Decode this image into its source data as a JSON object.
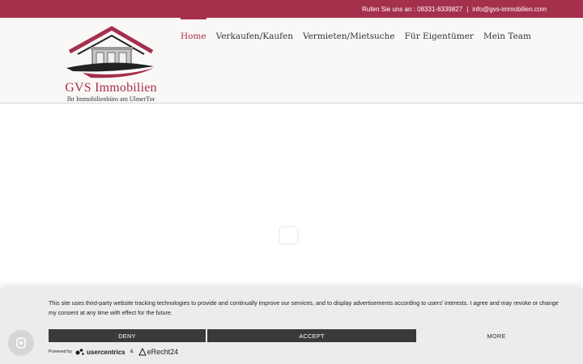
{
  "topbar": {
    "phone_text": "Rufen Sie uns an : 08331-8339827",
    "separator": "|",
    "email": "info@gvs-immobilien.com"
  },
  "logo": {
    "title": "GVS Immobilien",
    "subtitle": "Ihr Immobilienbüro am UlmerTor"
  },
  "nav": {
    "items": [
      {
        "label": "Home"
      },
      {
        "label": "Verkaufen/Kaufen"
      },
      {
        "label": "Vermieten/Mietsuche"
      },
      {
        "label": "Für Eigentümer"
      },
      {
        "label": "Mein Team"
      }
    ]
  },
  "consent": {
    "text": "This site uses third-party website tracking technologies to provide and continually improve our services, and to display advertisements according to users' interests. I agree and may revoke or change my consent at any time with effect for the future.",
    "deny_label": "DENY",
    "accept_label": "ACCEPT",
    "more_label": "MORE",
    "powered_by": "Powered by",
    "usercentrics": "usercentrics",
    "amp": "&",
    "erecht": "eRecht24"
  },
  "colors": {
    "brand": "#a5304c",
    "header_bg": "#faf8f7",
    "button_dark": "#3a3a3a"
  }
}
